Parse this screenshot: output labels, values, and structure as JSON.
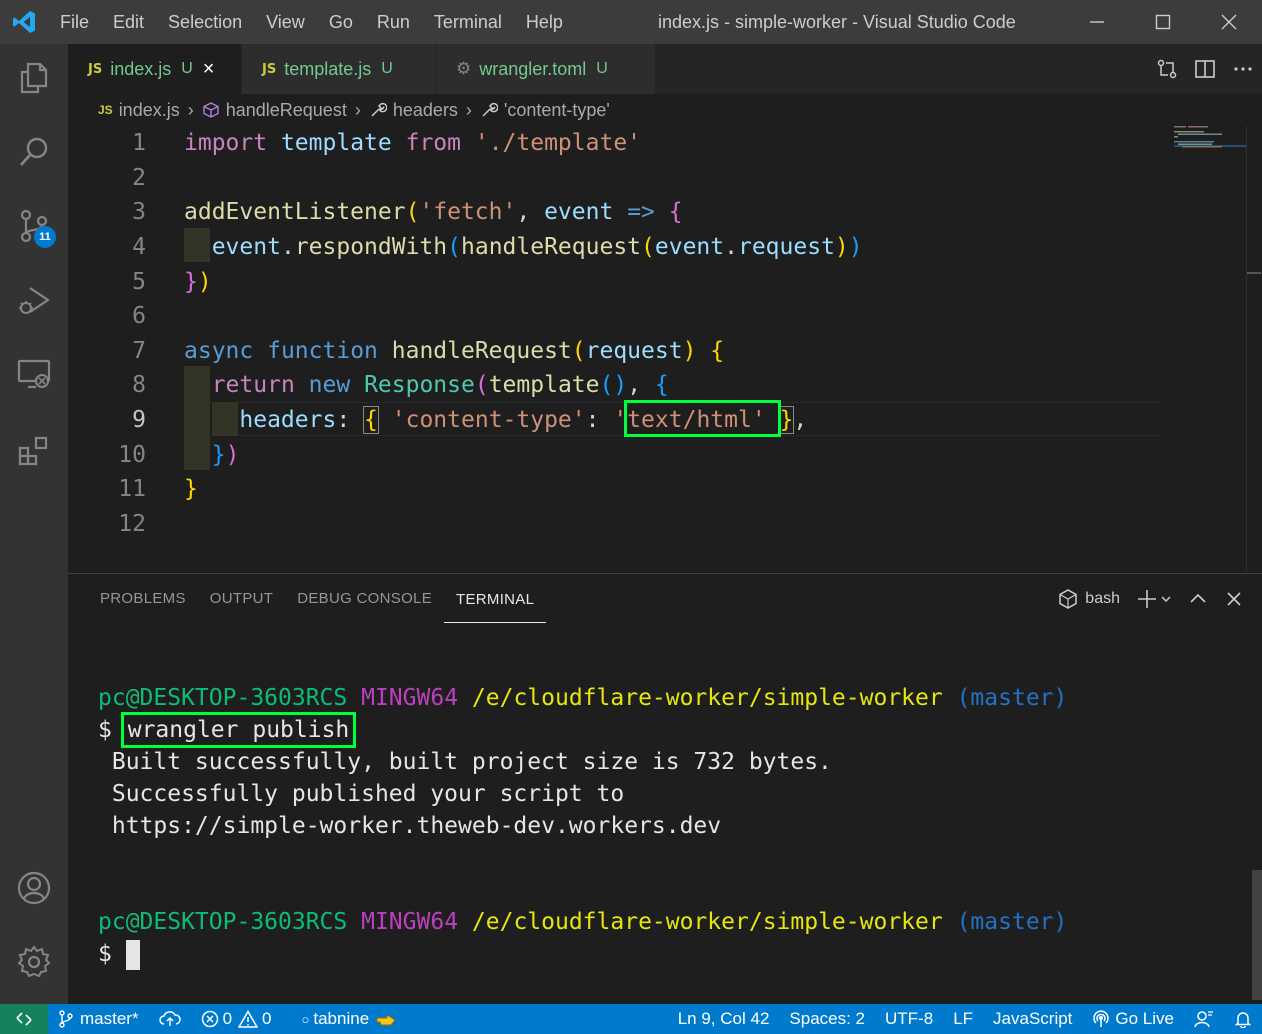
{
  "titlebar": {
    "menu": [
      "File",
      "Edit",
      "Selection",
      "View",
      "Go",
      "Run",
      "Terminal",
      "Help"
    ],
    "title": "index.js - simple-worker - Visual Studio Code"
  },
  "activity": {
    "items": [
      "explorer-icon",
      "search-icon",
      "source-control-icon",
      "run-debug-icon",
      "remote-explorer-icon",
      "extensions-icon",
      "account-icon",
      "settings-gear-icon"
    ],
    "scm_badge": "11"
  },
  "tabs": [
    {
      "icon": "JS",
      "name": "index.js",
      "status": "U",
      "close": "×"
    },
    {
      "icon": "JS",
      "name": "template.js",
      "status": "U"
    },
    {
      "icon": "⚙",
      "name": "wrangler.toml",
      "status": "U"
    }
  ],
  "breadcrumb": {
    "file_icon": "JS",
    "items": [
      "index.js",
      "handleRequest",
      "headers",
      "'content-type'"
    ]
  },
  "editor": {
    "line_numbers": [
      "1",
      "2",
      "3",
      "4",
      "5",
      "6",
      "7",
      "8",
      "9",
      "10",
      "11",
      "12"
    ],
    "current_line": "9",
    "line1": {
      "a": "import",
      "b": "template",
      "c": "from",
      "d": "'./template'"
    },
    "line3": {
      "a": "addEventListener",
      "b": "(",
      "c": "'fetch'",
      "d": ",",
      "e": "event",
      "f": "=>",
      "g": "{"
    },
    "line4": {
      "a": "event",
      "b": ".",
      "c": "respondWith",
      "d": "(",
      "e": "handleRequest",
      "f": "(",
      "g": "event",
      "h": ".",
      "i": "request",
      "j": ")",
      "k": ")"
    },
    "line5": {
      "a": "}",
      "b": ")"
    },
    "line7": {
      "a": "async",
      "b": "function",
      "c": "handleRequest",
      "d": "(",
      "e": "request",
      "f": ")",
      "g": "{"
    },
    "line8": {
      "a": "return",
      "b": "new",
      "c": "Response",
      "d": "(",
      "e": "template",
      "f": "()",
      "g": ",",
      "h": "{"
    },
    "line9": {
      "a": "headers",
      "b": ":",
      "c": "{",
      "d": "'content-type'",
      "e": ":",
      "f": "'text/html'",
      "g": "}",
      "h": ","
    },
    "line10": {
      "a": "}",
      "b": ")"
    },
    "line11": {
      "a": "}"
    }
  },
  "panel": {
    "tabs": [
      "PROBLEMS",
      "OUTPUT",
      "DEBUG CONSOLE",
      "TERMINAL"
    ],
    "shell": "bash",
    "terminal": {
      "prompt1": {
        "user": "pc@DESKTOP-3603RCS",
        "host": "MINGW64",
        "path": "/e/cloudflare-worker/simple-worker",
        "branch": "(master)"
      },
      "cmd_prefix": "$",
      "command": "wrangler publish",
      "output": [
        " Built successfully, built project size is 732 bytes.",
        " Successfully published your script to",
        " https://simple-worker.theweb-dev.workers.dev"
      ],
      "prompt2": {
        "user": "pc@DESKTOP-3603RCS",
        "host": "MINGW64",
        "path": "/e/cloudflare-worker/simple-worker",
        "branch": "(master)"
      },
      "cmd_prefix2": "$"
    }
  },
  "statusbar": {
    "branch": "master*",
    "errors": "0",
    "warnings": "0",
    "tabnine": "tabnine",
    "position": "Ln 9, Col 42",
    "spaces": "Spaces: 2",
    "encoding": "UTF-8",
    "eol": "LF",
    "language": "JavaScript",
    "golive": "Go Live"
  },
  "colors": {
    "accent": "#007acc",
    "highlight_box": "#00ff3c",
    "remote": "#16825d"
  }
}
